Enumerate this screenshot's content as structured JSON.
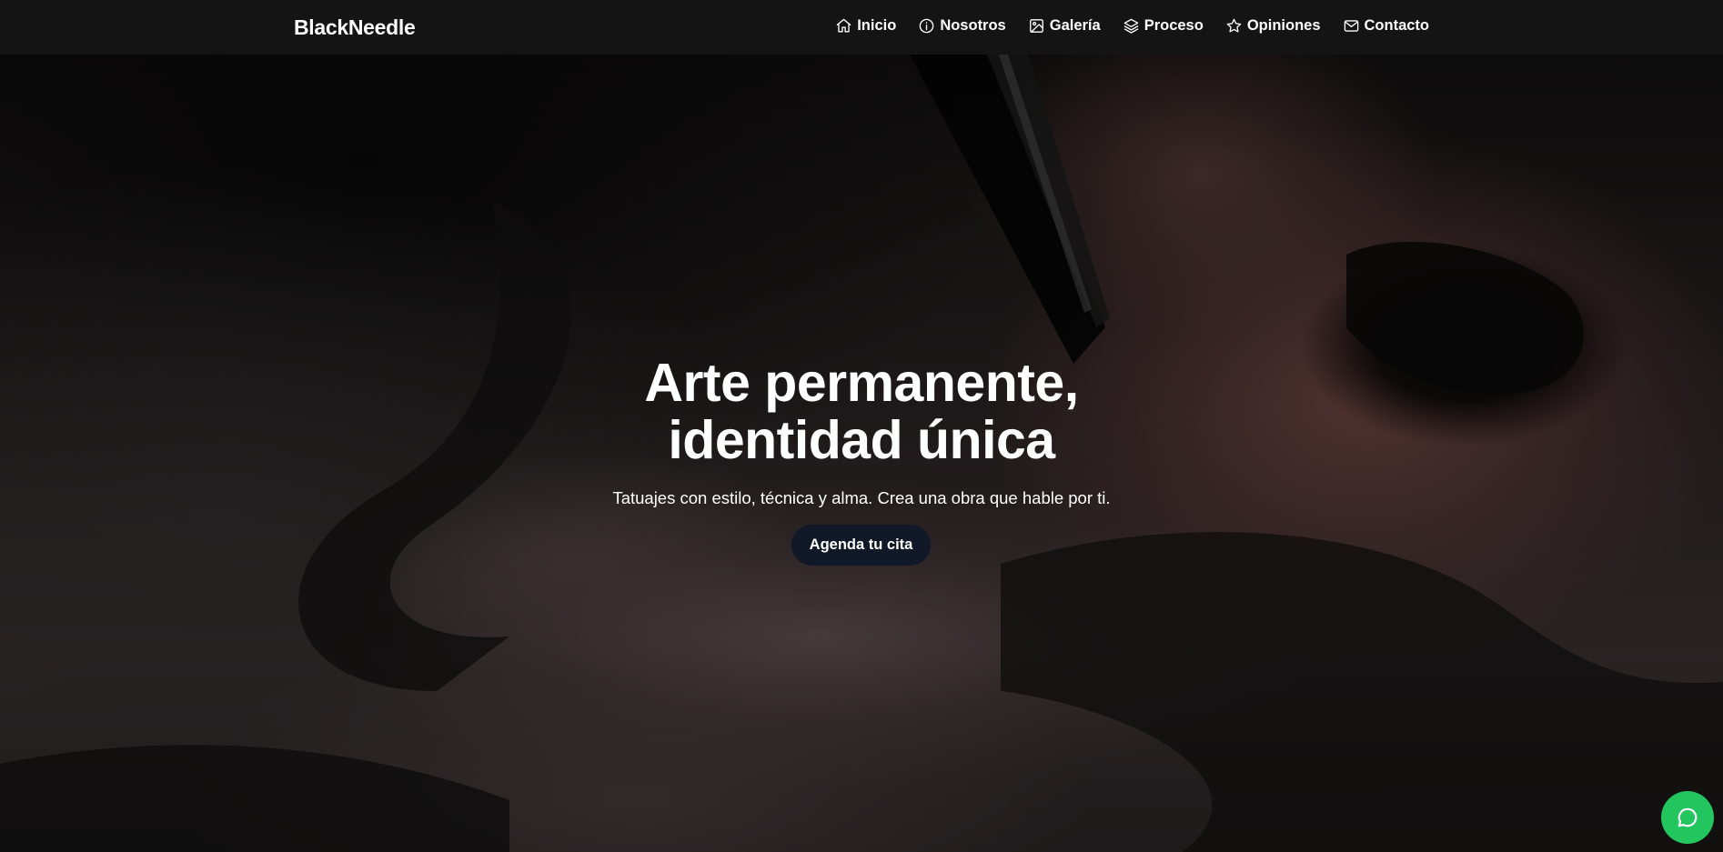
{
  "brand": "BlackNeedle",
  "nav": [
    {
      "label": "Inicio",
      "icon": "home-icon"
    },
    {
      "label": "Nosotros",
      "icon": "info-icon"
    },
    {
      "label": "Galería",
      "icon": "image-icon"
    },
    {
      "label": "Proceso",
      "icon": "layers-icon"
    },
    {
      "label": "Opiniones",
      "icon": "star-icon"
    },
    {
      "label": "Contacto",
      "icon": "mail-icon"
    }
  ],
  "hero": {
    "title_line1": "Arte permanente,",
    "title_line2": "identidad única",
    "subtitle": "Tatuajes con estilo, técnica y alma. Crea una obra que hable por ti.",
    "cta_label": "Agenda tu cita"
  },
  "chat": {
    "icon": "chat-bubble-icon"
  },
  "colors": {
    "navbar_bg": "#141414",
    "cta_bg": "#111827",
    "chat_bg": "#22c55e",
    "text": "#ffffff"
  }
}
